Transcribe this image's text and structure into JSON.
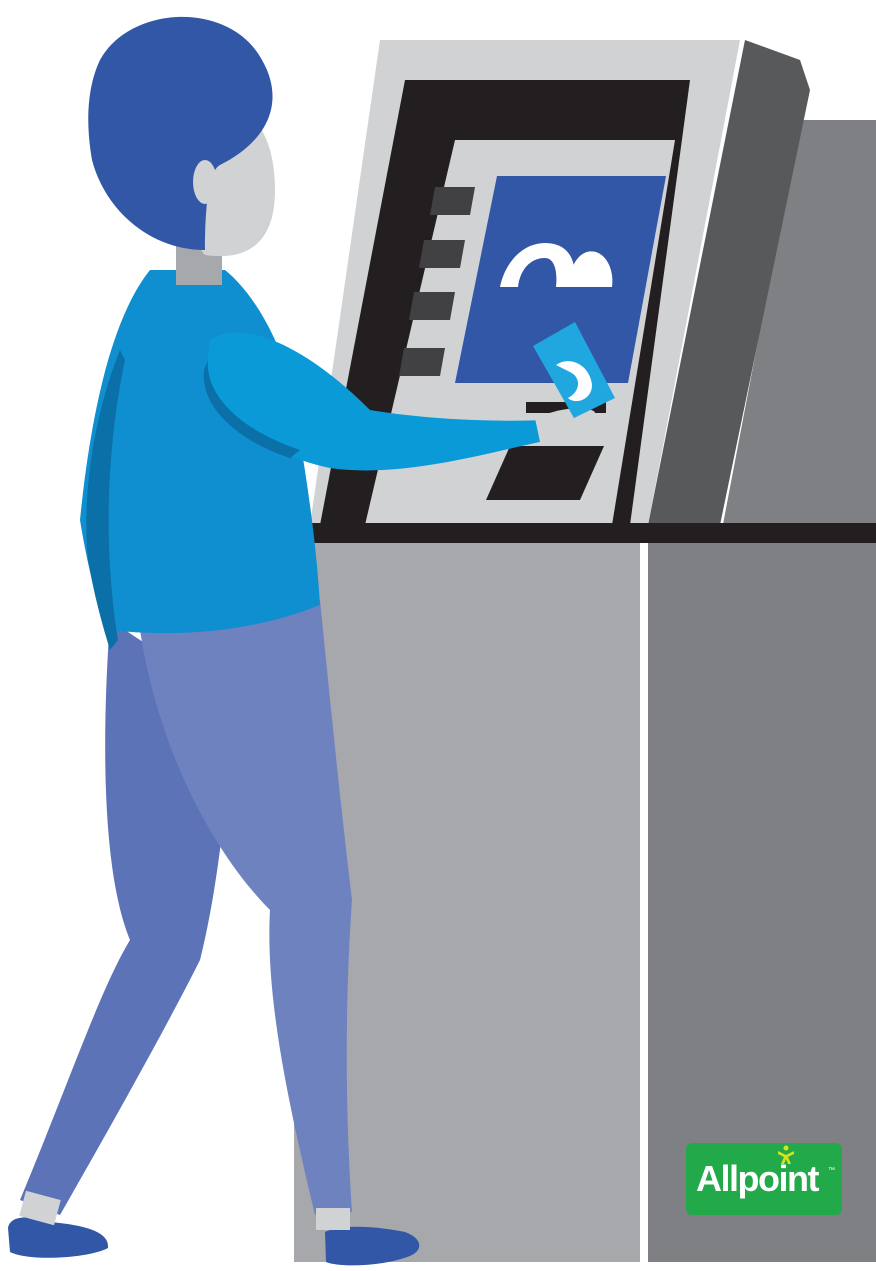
{
  "brand": {
    "name": "Allpoint",
    "trademark": "™",
    "badge_color": "#22a94a",
    "figure_color": "#d6e21a",
    "logo_icon": "allpoint-person-icon"
  },
  "palette": {
    "atm_body": "#a7a8ab",
    "atm_side": "#7f8083",
    "atm_frame_light": "#d1d2d4",
    "atm_frame_dark": "#231f20",
    "atm_screen": "#3157a6",
    "person_hair": "#3157a6",
    "person_shirt": "#0f8fd0",
    "person_pants": "#6f82c0",
    "person_shoes": "#3157a6",
    "card": "#20a7e0"
  }
}
